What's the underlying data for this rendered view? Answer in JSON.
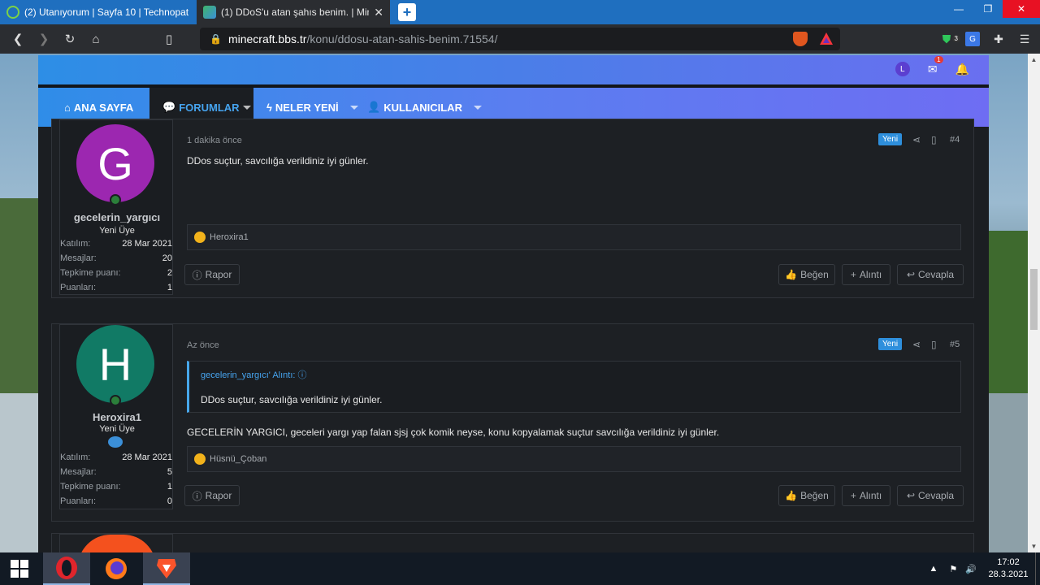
{
  "browser": {
    "tabs": [
      {
        "title": "(2) Utanıyorum | Sayfa 10 | Technopat",
        "active": false
      },
      {
        "title": "(1) DDoS'u atan şahıs benim. | Min",
        "active": true
      }
    ],
    "url_domain": "minecraft.bbs.tr",
    "url_path": "/konu/ddosu-atan-sahis-benim.71554/",
    "ext_badge": "3"
  },
  "site": {
    "avatar_letter": "L",
    "inbox_badge": "1",
    "nav": [
      {
        "label": "ANA SAYFA"
      },
      {
        "label": "FORUMLAR"
      },
      {
        "label": "NELER YENİ"
      },
      {
        "label": "KULLANICILAR"
      }
    ]
  },
  "posts": [
    {
      "letter": "G",
      "avatar_color": "#9c27b0",
      "username": "gecelerin_yargıcı",
      "usertitle": "Yeni Üye",
      "stats": [
        {
          "label": "Katılım:",
          "value": "28 Mar 2021"
        },
        {
          "label": "Mesajlar:",
          "value": "20"
        },
        {
          "label": "Tepkime puanı:",
          "value": "2"
        },
        {
          "label": "Puanları:",
          "value": "1"
        }
      ],
      "time": "1 dakika önce",
      "new_badge": "Yeni",
      "number": "#4",
      "text": "DDos suçtur, savcılığa verildiniz iyi günler.",
      "reaction_user": "Heroxira1"
    },
    {
      "letter": "H",
      "avatar_color": "#117a65",
      "username": "Heroxira1",
      "usertitle": "Yeni Üye",
      "stats": [
        {
          "label": "Katılım:",
          "value": "28 Mar 2021"
        },
        {
          "label": "Mesajlar:",
          "value": "5"
        },
        {
          "label": "Tepkime puanı:",
          "value": "1"
        },
        {
          "label": "Puanları:",
          "value": "0"
        }
      ],
      "time": "Az önce",
      "new_badge": "Yeni",
      "number": "#5",
      "quote_author": "gecelerin_yargıcı' Alıntı: ⓘ",
      "quote_text": "DDos suçtur, savcılığa verildiniz iyi günler.",
      "text": "GECELERİN YARGICI, geceleri yargı yap falan sjsj çok komik neyse, konu kopyalamak suçtur savcılığa verildiniz iyi günler.",
      "reaction_user": "Hüsnü_Çoban"
    }
  ],
  "actions": {
    "report": "Rapor",
    "like": "Beğen",
    "quote": "Alıntı",
    "reply": "Cevapla"
  },
  "taskbar": {
    "time": "17:02",
    "date": "28.3.2021"
  }
}
